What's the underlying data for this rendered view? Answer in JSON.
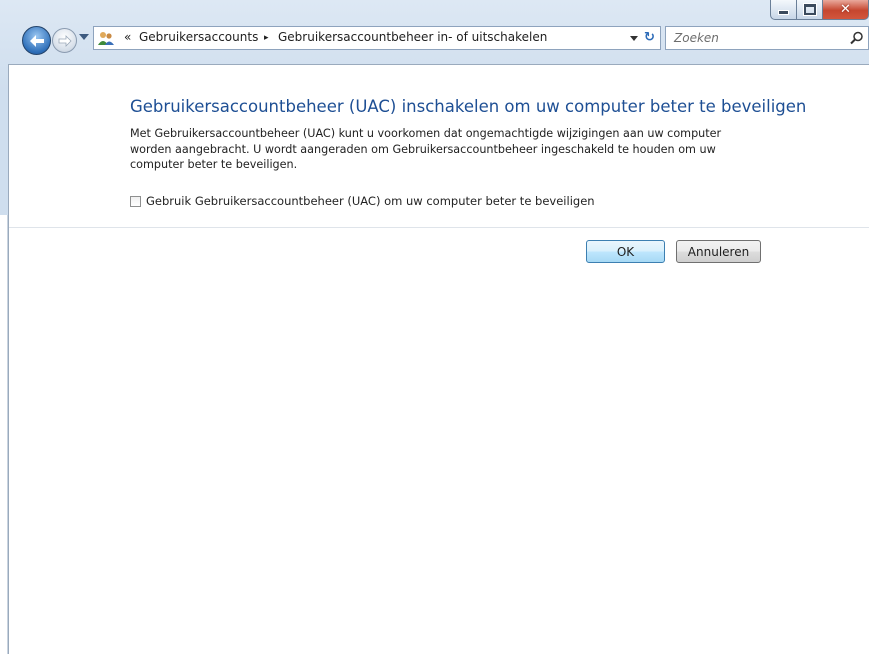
{
  "window": {
    "caption_buttons": [
      "minimize",
      "maximize",
      "close"
    ]
  },
  "navigation": {
    "back_icon": "back-arrow-icon",
    "forward_icon": "forward-arrow-icon",
    "address": {
      "overflow": "«",
      "crumbs": [
        "Gebruikersaccounts",
        "Gebruikersaccountbeheer in- of uitschakelen"
      ],
      "separator": "▸"
    },
    "search": {
      "placeholder": "Zoeken"
    }
  },
  "content": {
    "title": "Gebruikersaccountbeheer (UAC) inschakelen om uw computer beter te beveiligen",
    "description_lines": [
      "Met Gebruikersaccountbeheer (UAC) kunt u voorkomen dat ongemachtigde wijzigingen aan uw computer",
      "worden aangebracht. U wordt aangeraden om Gebruikersaccountbeheer ingeschakeld te houden om uw",
      "computer beter te beveiligen."
    ],
    "checkbox": {
      "label": "Gebruik Gebruikersaccountbeheer (UAC) om uw computer beter te beveiligen",
      "checked": false
    },
    "buttons": {
      "ok": "OK",
      "cancel": "Annuleren"
    }
  },
  "colors": {
    "title": "#1e4f94",
    "close_button": "#c6462f",
    "ok_button_border": "#3c7fb1"
  }
}
